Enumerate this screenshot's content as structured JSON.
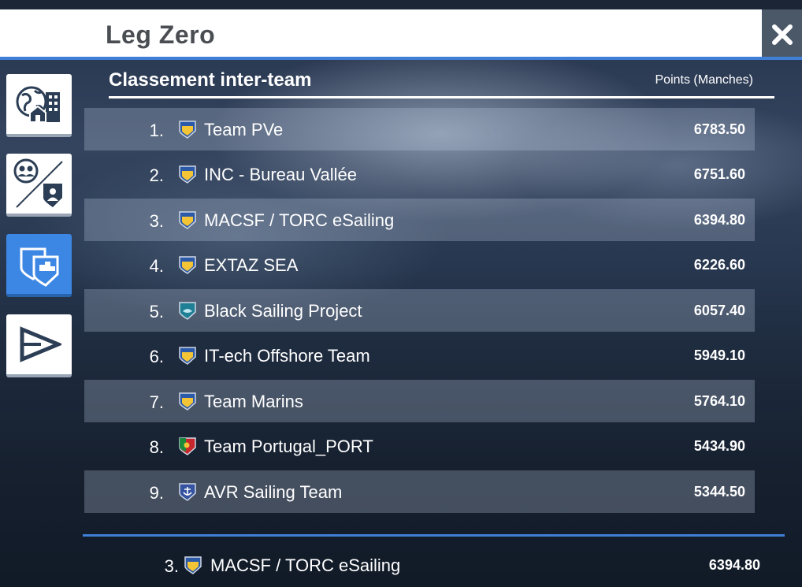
{
  "header": {
    "title": "Leg Zero",
    "close_icon": "close-icon"
  },
  "sidebar": {
    "items": [
      {
        "name": "world-city-icon",
        "active": false
      },
      {
        "name": "players-team-icon",
        "active": false
      },
      {
        "name": "team-podium-icon",
        "active": true
      },
      {
        "name": "flag-icon",
        "active": false
      }
    ]
  },
  "section": {
    "title": "Classement inter-team",
    "points_label": "Points (Manches)"
  },
  "rows": [
    {
      "rank": "1.",
      "team": "Team PVe",
      "score": "6783.50",
      "shield": "yellow-blue"
    },
    {
      "rank": "2.",
      "team": "INC - Bureau Vallée",
      "score": "6751.60",
      "shield": "yellow-blue"
    },
    {
      "rank": "3.",
      "team": "MACSF / TORC eSailing",
      "score": "6394.80",
      "shield": "yellow-blue"
    },
    {
      "rank": "4.",
      "team": "EXTAZ SEA",
      "score": "6226.60",
      "shield": "yellow-blue"
    },
    {
      "rank": "5.",
      "team": "Black Sailing Project",
      "score": "6057.40",
      "shield": "teal"
    },
    {
      "rank": "6.",
      "team": "IT-ech Offshore Team",
      "score": "5949.10",
      "shield": "yellow-blue"
    },
    {
      "rank": "7.",
      "team": "Team Marins",
      "score": "5764.10",
      "shield": "yellow-blue"
    },
    {
      "rank": "8.",
      "team": "Team Portugal_PORT",
      "score": "5434.90",
      "shield": "portugal"
    },
    {
      "rank": "9.",
      "team": "AVR Sailing Team",
      "score": "5344.50",
      "shield": "anchor"
    }
  ],
  "footer": {
    "rank": "3.",
    "team": "MACSF / TORC eSailing",
    "score": "6394.80",
    "shield": "yellow-blue"
  },
  "colors": {
    "accent": "#3f7fd6",
    "active_button": "#3c86e4",
    "header_bg": "#ffffff"
  }
}
